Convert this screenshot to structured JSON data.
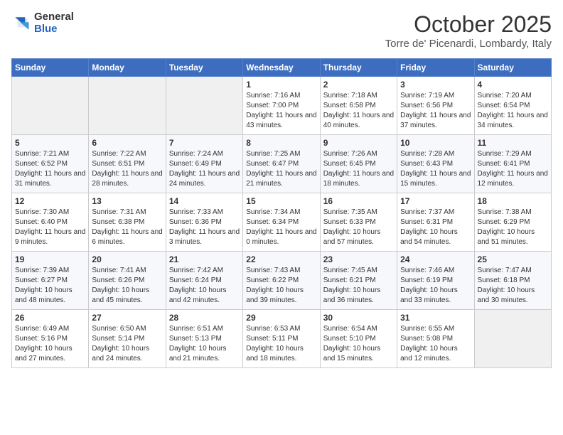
{
  "header": {
    "logo_general": "General",
    "logo_blue": "Blue",
    "month_title": "October 2025",
    "location": "Torre de' Picenardi, Lombardy, Italy"
  },
  "calendar": {
    "days_of_week": [
      "Sunday",
      "Monday",
      "Tuesday",
      "Wednesday",
      "Thursday",
      "Friday",
      "Saturday"
    ],
    "weeks": [
      [
        {
          "day": "",
          "info": ""
        },
        {
          "day": "",
          "info": ""
        },
        {
          "day": "",
          "info": ""
        },
        {
          "day": "1",
          "info": "Sunrise: 7:16 AM\nSunset: 7:00 PM\nDaylight: 11 hours and 43 minutes."
        },
        {
          "day": "2",
          "info": "Sunrise: 7:18 AM\nSunset: 6:58 PM\nDaylight: 11 hours and 40 minutes."
        },
        {
          "day": "3",
          "info": "Sunrise: 7:19 AM\nSunset: 6:56 PM\nDaylight: 11 hours and 37 minutes."
        },
        {
          "day": "4",
          "info": "Sunrise: 7:20 AM\nSunset: 6:54 PM\nDaylight: 11 hours and 34 minutes."
        }
      ],
      [
        {
          "day": "5",
          "info": "Sunrise: 7:21 AM\nSunset: 6:52 PM\nDaylight: 11 hours and 31 minutes."
        },
        {
          "day": "6",
          "info": "Sunrise: 7:22 AM\nSunset: 6:51 PM\nDaylight: 11 hours and 28 minutes."
        },
        {
          "day": "7",
          "info": "Sunrise: 7:24 AM\nSunset: 6:49 PM\nDaylight: 11 hours and 24 minutes."
        },
        {
          "day": "8",
          "info": "Sunrise: 7:25 AM\nSunset: 6:47 PM\nDaylight: 11 hours and 21 minutes."
        },
        {
          "day": "9",
          "info": "Sunrise: 7:26 AM\nSunset: 6:45 PM\nDaylight: 11 hours and 18 minutes."
        },
        {
          "day": "10",
          "info": "Sunrise: 7:28 AM\nSunset: 6:43 PM\nDaylight: 11 hours and 15 minutes."
        },
        {
          "day": "11",
          "info": "Sunrise: 7:29 AM\nSunset: 6:41 PM\nDaylight: 11 hours and 12 minutes."
        }
      ],
      [
        {
          "day": "12",
          "info": "Sunrise: 7:30 AM\nSunset: 6:40 PM\nDaylight: 11 hours and 9 minutes."
        },
        {
          "day": "13",
          "info": "Sunrise: 7:31 AM\nSunset: 6:38 PM\nDaylight: 11 hours and 6 minutes."
        },
        {
          "day": "14",
          "info": "Sunrise: 7:33 AM\nSunset: 6:36 PM\nDaylight: 11 hours and 3 minutes."
        },
        {
          "day": "15",
          "info": "Sunrise: 7:34 AM\nSunset: 6:34 PM\nDaylight: 11 hours and 0 minutes."
        },
        {
          "day": "16",
          "info": "Sunrise: 7:35 AM\nSunset: 6:33 PM\nDaylight: 10 hours and 57 minutes."
        },
        {
          "day": "17",
          "info": "Sunrise: 7:37 AM\nSunset: 6:31 PM\nDaylight: 10 hours and 54 minutes."
        },
        {
          "day": "18",
          "info": "Sunrise: 7:38 AM\nSunset: 6:29 PM\nDaylight: 10 hours and 51 minutes."
        }
      ],
      [
        {
          "day": "19",
          "info": "Sunrise: 7:39 AM\nSunset: 6:27 PM\nDaylight: 10 hours and 48 minutes."
        },
        {
          "day": "20",
          "info": "Sunrise: 7:41 AM\nSunset: 6:26 PM\nDaylight: 10 hours and 45 minutes."
        },
        {
          "day": "21",
          "info": "Sunrise: 7:42 AM\nSunset: 6:24 PM\nDaylight: 10 hours and 42 minutes."
        },
        {
          "day": "22",
          "info": "Sunrise: 7:43 AM\nSunset: 6:22 PM\nDaylight: 10 hours and 39 minutes."
        },
        {
          "day": "23",
          "info": "Sunrise: 7:45 AM\nSunset: 6:21 PM\nDaylight: 10 hours and 36 minutes."
        },
        {
          "day": "24",
          "info": "Sunrise: 7:46 AM\nSunset: 6:19 PM\nDaylight: 10 hours and 33 minutes."
        },
        {
          "day": "25",
          "info": "Sunrise: 7:47 AM\nSunset: 6:18 PM\nDaylight: 10 hours and 30 minutes."
        }
      ],
      [
        {
          "day": "26",
          "info": "Sunrise: 6:49 AM\nSunset: 5:16 PM\nDaylight: 10 hours and 27 minutes."
        },
        {
          "day": "27",
          "info": "Sunrise: 6:50 AM\nSunset: 5:14 PM\nDaylight: 10 hours and 24 minutes."
        },
        {
          "day": "28",
          "info": "Sunrise: 6:51 AM\nSunset: 5:13 PM\nDaylight: 10 hours and 21 minutes."
        },
        {
          "day": "29",
          "info": "Sunrise: 6:53 AM\nSunset: 5:11 PM\nDaylight: 10 hours and 18 minutes."
        },
        {
          "day": "30",
          "info": "Sunrise: 6:54 AM\nSunset: 5:10 PM\nDaylight: 10 hours and 15 minutes."
        },
        {
          "day": "31",
          "info": "Sunrise: 6:55 AM\nSunset: 5:08 PM\nDaylight: 10 hours and 12 minutes."
        },
        {
          "day": "",
          "info": ""
        }
      ]
    ]
  }
}
